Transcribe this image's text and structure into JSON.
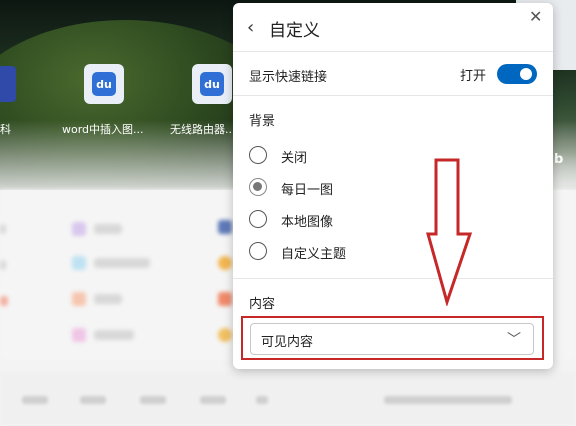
{
  "background": {
    "tiles": [
      {
        "label": "科"
      },
      {
        "label": "word中插入图..."
      },
      {
        "label": "无线路由器..."
      }
    ],
    "tile_glyph": "du",
    "bing_glyph": "b"
  },
  "panel": {
    "title": "自定义",
    "back_icon": "‹",
    "close_icon": "✕",
    "quick_links": {
      "label": "显示快速链接",
      "state": "打开",
      "on": true
    },
    "background_section": {
      "label": "背景",
      "options": [
        {
          "label": "关闭",
          "checked": false
        },
        {
          "label": "每日一图",
          "checked": true
        },
        {
          "label": "本地图像",
          "checked": false
        },
        {
          "label": "自定义主题",
          "checked": false
        }
      ]
    },
    "content_section": {
      "label": "内容",
      "selected": "可见内容",
      "chevron": "﹀"
    }
  },
  "annotation": {
    "highlight_color": "#c62828"
  }
}
